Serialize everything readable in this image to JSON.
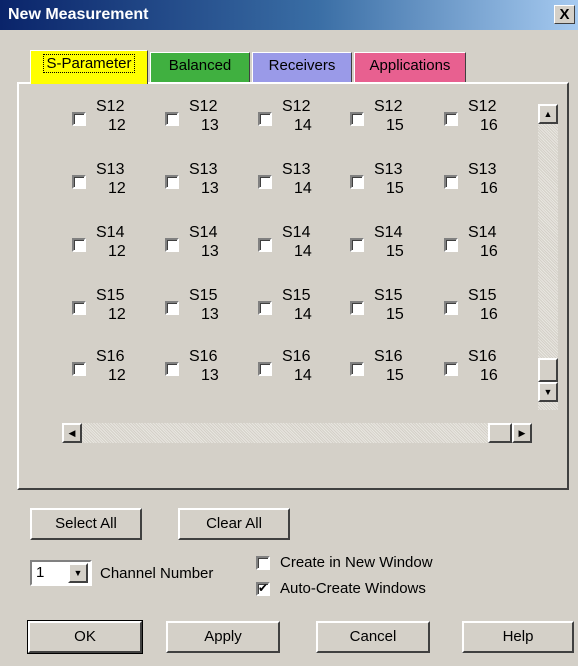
{
  "window": {
    "title": "New Measurement",
    "close_label": "X"
  },
  "tabs": [
    {
      "label": "S-Parameter",
      "color": "#ffff00",
      "active": true
    },
    {
      "label": "Balanced",
      "color": "#40b040"
    },
    {
      "label": "Receivers",
      "color": "#9a9ae8"
    },
    {
      "label": "Applications",
      "color": "#e86090"
    }
  ],
  "grid": {
    "rows": [
      {
        "param": "S12",
        "ports": [
          "12",
          "13",
          "14",
          "15",
          "16"
        ]
      },
      {
        "param": "S13",
        "ports": [
          "12",
          "13",
          "14",
          "15",
          "16"
        ]
      },
      {
        "param": "S14",
        "ports": [
          "12",
          "13",
          "14",
          "15",
          "16"
        ]
      },
      {
        "param": "S15",
        "ports": [
          "12",
          "13",
          "14",
          "15",
          "16"
        ]
      },
      {
        "param": "S16",
        "ports": [
          "12",
          "13",
          "14",
          "15",
          "16"
        ]
      }
    ]
  },
  "buttons": {
    "select_all": "Select All",
    "clear_all": "Clear All",
    "ok": "OK",
    "apply": "Apply",
    "cancel": "Cancel",
    "help": "Help"
  },
  "channel": {
    "value": "1",
    "label": "Channel Number"
  },
  "options": {
    "create_new_window": {
      "label": "Create in New Window",
      "checked": false
    },
    "auto_create_windows": {
      "label": "Auto-Create Windows",
      "checked": true
    }
  },
  "icons": {
    "scroll_up": "scroll-up-arrow-icon",
    "scroll_down": "scroll-down-arrow-icon",
    "scroll_left": "scroll-left-arrow-icon",
    "scroll_right": "scroll-right-arrow-icon",
    "dropdown": "dropdown-arrow-icon"
  }
}
